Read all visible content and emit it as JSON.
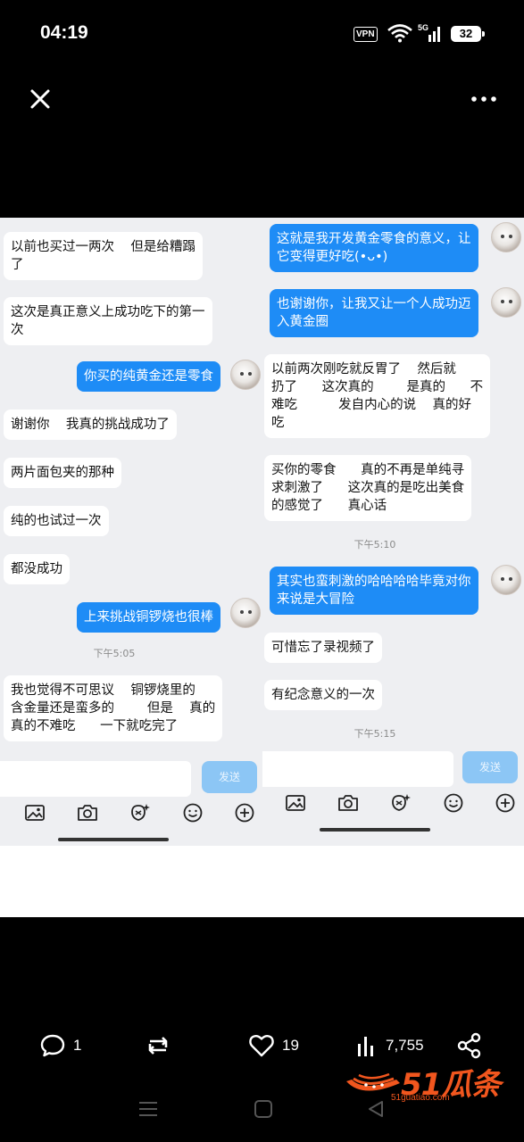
{
  "status_bar": {
    "time": "04:19",
    "vpn": "VPN",
    "network": "5G",
    "battery": "32"
  },
  "left_panel": {
    "messages": [
      {
        "side": "other",
        "text": "以前也买过一两次    但是给糟蹋\n了"
      },
      {
        "side": "other",
        "text": "这次是真正意义上成功吃下的第一\n次"
      },
      {
        "side": "me",
        "text": "你买的纯黄金还是零食"
      },
      {
        "side": "other",
        "text": "谢谢你    我真的挑战成功了"
      },
      {
        "side": "other",
        "text": "两片面包夹的那种"
      },
      {
        "side": "other",
        "text": "纯的也试过一次"
      },
      {
        "side": "other",
        "text": "都没成功"
      },
      {
        "side": "me",
        "text": "上来挑战铜锣烧也很棒"
      },
      {
        "side": "other",
        "text": "我也觉得不可思议    铜锣烧里的\n含金量还是蛮多的        但是    真的\n真的不难吃      一下就吃完了"
      }
    ],
    "timestamp": "下午5:05",
    "send_label": "发送"
  },
  "right_panel": {
    "messages": [
      {
        "side": "me",
        "text": "这就是我开发黄金零食的意义，让\n它变得更好吃(•ᴗ•)"
      },
      {
        "side": "me",
        "text": "也谢谢你，让我又让一个人成功迈\n入黄金圈"
      },
      {
        "side": "other",
        "text": "以前两次刚吃就反胃了    然后就\n扔了      这次真的        是真的      不\n难吃          发自内心的说    真的好\n吃"
      },
      {
        "side": "other",
        "text": "买你的零食      真的不再是单纯寻\n求刺激了      这次真的是吃出美食\n的感觉了      真心话"
      },
      {
        "side": "me",
        "text": "其实也蛮刺激的哈哈哈哈毕竟对你\n来说是大冒险"
      },
      {
        "side": "other",
        "text": "可惜忘了录视频了"
      },
      {
        "side": "other",
        "text": "有纪念意义的一次"
      }
    ],
    "timestamps": [
      "下午5:10",
      "下午5:15"
    ],
    "send_label": "发送"
  },
  "actions": {
    "comments": "1",
    "likes": "19",
    "views": "7,755"
  },
  "watermark": {
    "brand": "51瓜条",
    "url": "51guatiao.com"
  }
}
